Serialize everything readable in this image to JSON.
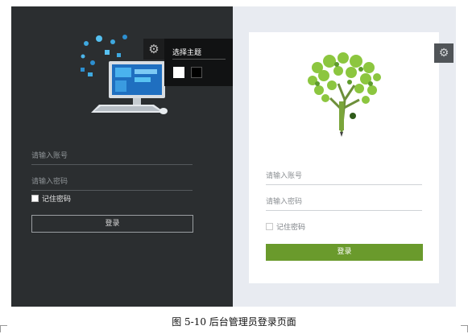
{
  "dark_login": {
    "username_placeholder": "请输入账号",
    "password_placeholder": "请输入密码",
    "remember_label": "记住密码",
    "login_label": "登录",
    "background_color": "#2b2e30"
  },
  "theme_picker": {
    "title": "选择主题",
    "swatches": [
      "#ffffff",
      "#000000"
    ],
    "icon": "gear-icon"
  },
  "light_login": {
    "username_placeholder": "请输入账号",
    "password_placeholder": "请输入密码",
    "remember_label": "记住密码",
    "login_label": "登录",
    "button_color": "#6a9a2c",
    "icon": "gear-icon"
  },
  "caption": "图 5-10 后台管理员登录页面"
}
